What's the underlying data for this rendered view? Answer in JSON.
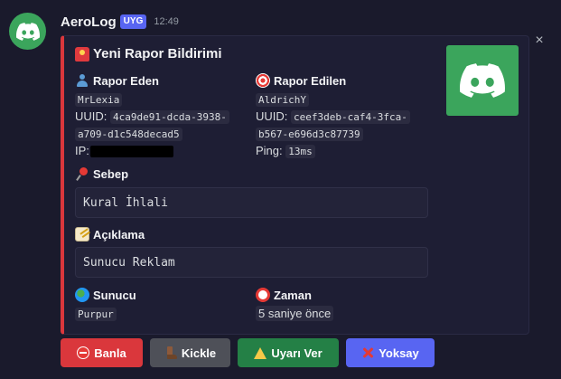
{
  "message": {
    "username": "AeroLog",
    "app_badge": "UYG",
    "timestamp": "12:49"
  },
  "colors": {
    "embed_accent": "#da373c",
    "avatar_bg": "#3ba55c",
    "badge": "#5865f2"
  },
  "embed": {
    "title": "Yeni Rapor Bildirimi",
    "title_icon": "rotating-light-icon",
    "thumbnail_icon": "discord-logo",
    "reporter": {
      "label": "Rapor Eden",
      "icon": "bust-icon",
      "name": "MrLexia",
      "uuid_label": "UUID:",
      "uuid_line1": "4ca9de91-dcda-3938-",
      "uuid_line2": "a709-d1c548decad5",
      "ip_label": "IP:"
    },
    "reported": {
      "label": "Rapor Edilen",
      "icon": "target-icon",
      "name": "AldrichY",
      "uuid_label": "UUID:",
      "uuid_line1": "ceef3deb-caf4-3fca-",
      "uuid_line2": "b567-e696d3c87739",
      "ping_label": "Ping:",
      "ping_value": "13ms"
    },
    "reason": {
      "label": "Sebep",
      "icon": "pushpin-icon",
      "value": "Kural İhlali"
    },
    "description": {
      "label": "Açıklama",
      "icon": "memo-icon",
      "value": "Sunucu Reklam"
    },
    "server": {
      "label": "Sunucu",
      "icon": "globe-icon",
      "value": "Purpur"
    },
    "time": {
      "label": "Zaman",
      "icon": "alarm-clock-icon",
      "value": "5 saniye önce"
    }
  },
  "buttons": {
    "ban": "Banla",
    "kick": "Kickle",
    "warn": "Uyarı Ver",
    "dismiss": "Yoksay"
  }
}
